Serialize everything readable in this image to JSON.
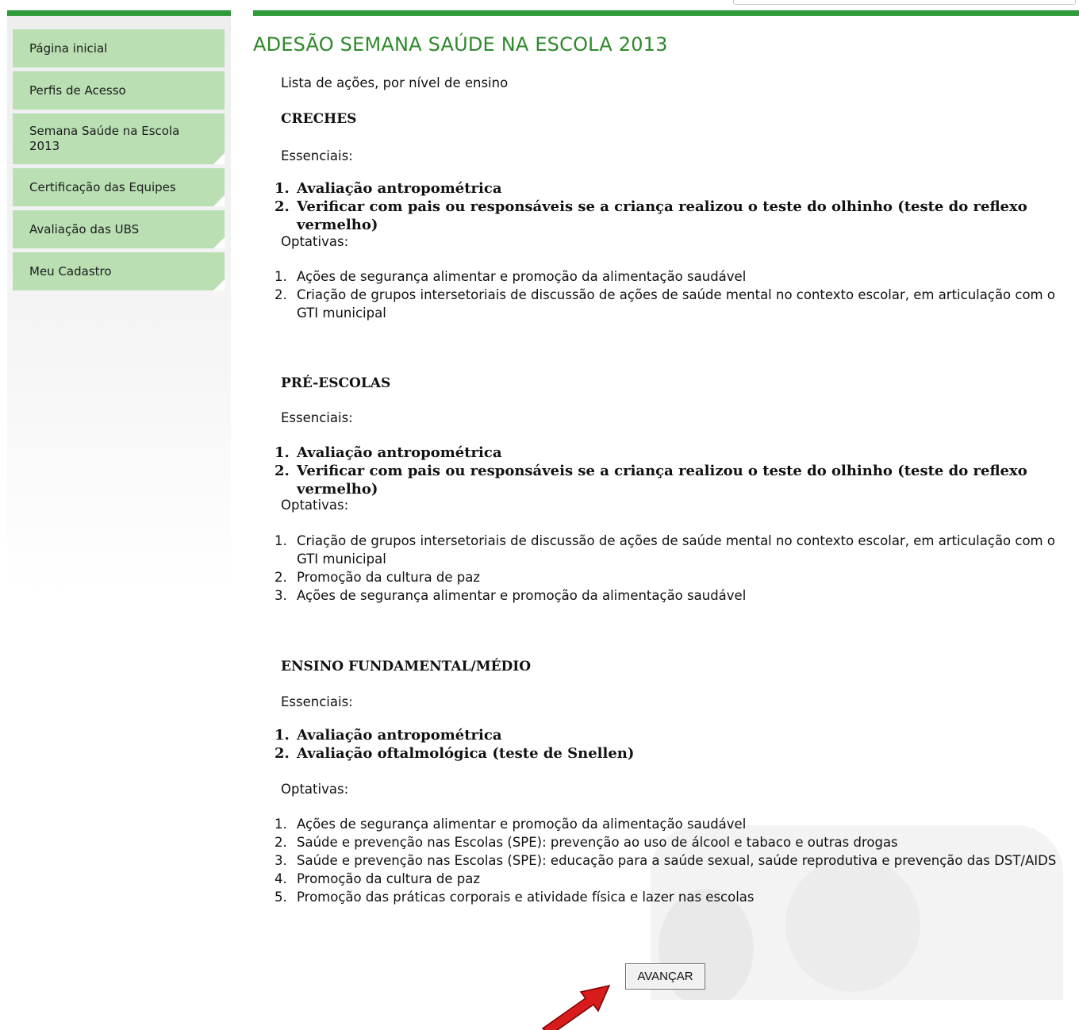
{
  "sidebar": {
    "items": [
      {
        "label": "Página inicial"
      },
      {
        "label": "Perfis de Acesso"
      },
      {
        "label": "Semana Saúde na Escola 2013"
      },
      {
        "label": "Certificação das Equipes"
      },
      {
        "label": "Avaliação das UBS"
      },
      {
        "label": "Meu Cadastro"
      }
    ]
  },
  "main": {
    "title": "ADESÃO SEMANA SAÚDE NA ESCOLA 2013",
    "intro": "Lista de ações, por nível de ensino",
    "sections": [
      {
        "title": "CRECHES",
        "essenciais_label": "Essenciais:",
        "essenciais": [
          "Avaliação antropométrica",
          "Verificar com pais ou responsáveis se a criança realizou o teste do olhinho (teste do reflexo vermelho)"
        ],
        "optativas_label": "Optativas:",
        "optativas": [
          "Ações de segurança alimentar e promoção da alimentação saudável",
          "Criação de grupos intersetoriais de discussão de ações de saúde mental no contexto escolar, em articulação com o GTI municipal"
        ]
      },
      {
        "title": "PRÉ-ESCOLAS",
        "essenciais_label": "Essenciais:",
        "essenciais": [
          "Avaliação antropométrica",
          "Verificar com pais ou responsáveis se a criança realizou o teste do olhinho (teste do reflexo vermelho)"
        ],
        "optativas_label": "Optativas:",
        "optativas": [
          "Criação de grupos intersetoriais de discussão de ações de saúde mental no contexto escolar, em articulação com o GTI municipal",
          "Promoção da cultura de paz",
          "Ações de segurança alimentar e promoção da alimentação saudável"
        ]
      },
      {
        "title": "ENSINO FUNDAMENTAL/MÉDIO",
        "essenciais_label": "Essenciais:",
        "essenciais": [
          "Avaliação antropométrica",
          "Avaliação oftalmológica (teste de Snellen)"
        ],
        "optativas_label": "Optativas:",
        "optativas": [
          "Ações de segurança alimentar e promoção da alimentação saudável",
          "Saúde e prevenção nas Escolas (SPE): prevenção ao uso de álcool e tabaco e outras drogas",
          "Saúde e prevenção nas Escolas (SPE): educação para a saúde sexual, saúde reprodutiva e prevenção das DST/AIDS",
          "Promoção da cultura de paz",
          "Promoção das práticas corporais e atividade física e lazer nas escolas"
        ]
      }
    ],
    "numbers": [
      "1.",
      "2.",
      "3.",
      "4.",
      "5."
    ],
    "button_label": "AVANÇAR"
  },
  "colors": {
    "brand_green": "#2e9b3a",
    "menu_green": "#b9dfb3",
    "title_green": "#2e8a2a",
    "arrow_red": "#d81c1c"
  }
}
